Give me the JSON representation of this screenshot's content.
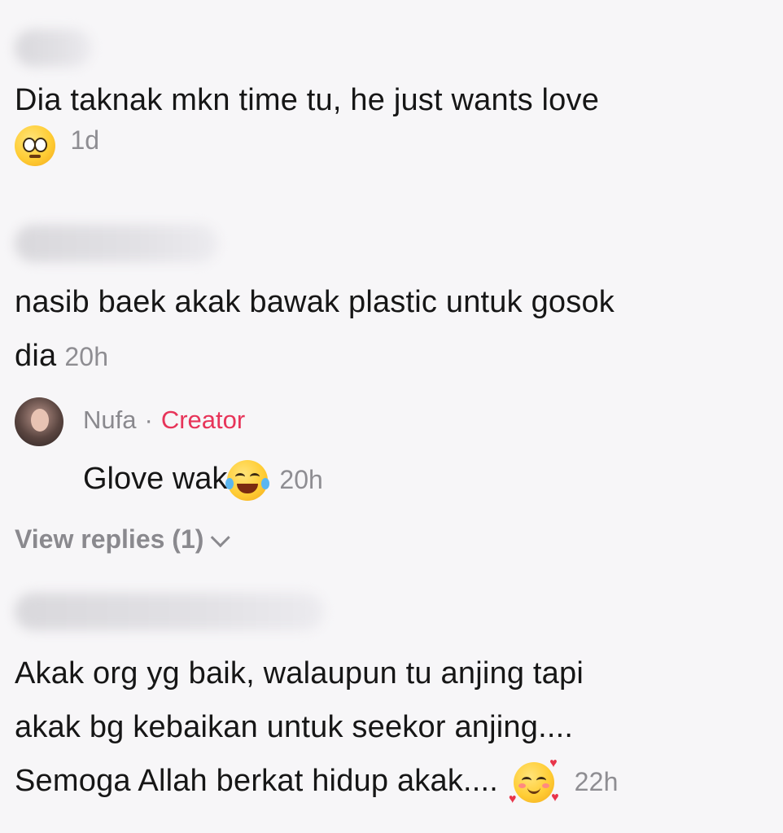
{
  "comments": [
    {
      "text": "Dia taknak mkn time tu, he just wants love",
      "emoji": "pleading-face-emoji",
      "time": "1d"
    },
    {
      "text_line1": "nasib baek akak bawak plastic untuk gosok",
      "text_line2": "dia",
      "time": "20h",
      "reply": {
        "author": "Nufa",
        "separator": "·",
        "badge": "Creator",
        "text": "Glove wak",
        "emoji": "tears-of-joy-emoji",
        "time": "20h"
      },
      "view_replies": "View replies (1)"
    },
    {
      "text_line1": "Akak org yg baik, walaupun tu anjing tapi",
      "text_line2": "akak bg kebaikan untuk seekor anjing....",
      "text_line3": "Semoga Allah berkat hidup akak....",
      "emoji": "smiling-face-with-hearts-emoji",
      "time": "22h"
    }
  ],
  "colors": {
    "background": "#f7f6f8",
    "creator_badge": "#e73459",
    "muted": "#8a898e"
  }
}
